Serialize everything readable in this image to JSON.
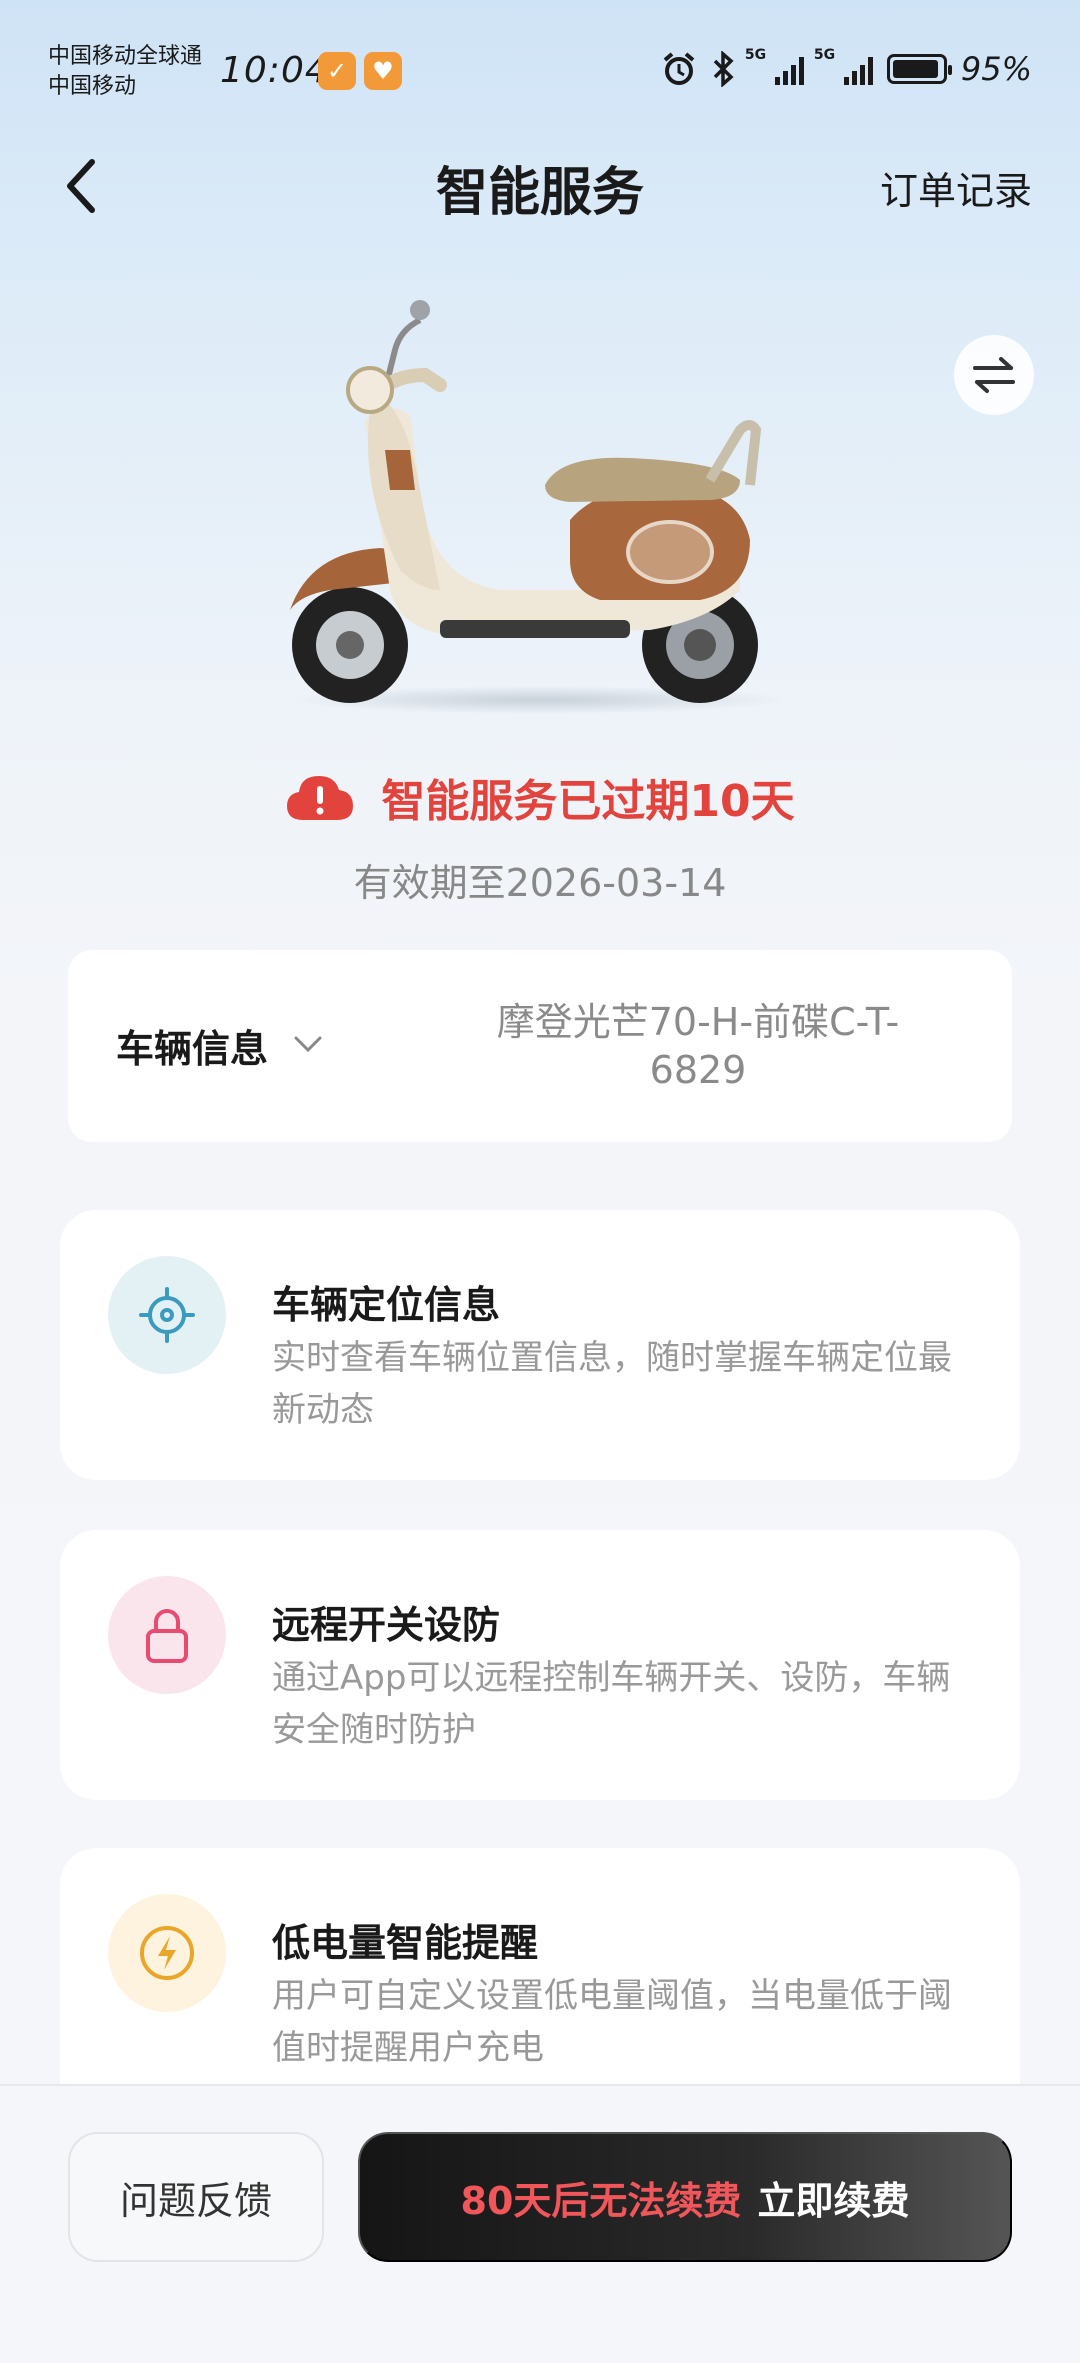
{
  "status_bar": {
    "carrier_1": "中国移动全球通",
    "carrier_2": "中国移动",
    "time": "10:04",
    "network_1": "5G",
    "network_2": "5G",
    "battery_text": "95%",
    "battery_level": 0.95,
    "icons": [
      "alarm-icon",
      "bluetooth-icon",
      "signal-icon",
      "battery-icon"
    ]
  },
  "header": {
    "title": "智能服务",
    "orders_link": "订单记录"
  },
  "status": {
    "expired_message": "智能服务已过期10天",
    "valid_until": "有效期至2026-03-14",
    "warning_color": "#e2443d"
  },
  "vehicle": {
    "label": "车辆信息",
    "name": "摩登光芒70-H-前碟C-T-6829"
  },
  "services": [
    {
      "title": "车辆定位信息",
      "description": "实时查看车辆位置信息，随时掌握车辆定位最新动态",
      "icon": "location-target-icon",
      "accent": "#3a9bbf"
    },
    {
      "title": "远程开关设防",
      "description": "通过App可以远程控制车辆开关、设防，车辆安全随时防护",
      "icon": "lock-icon",
      "accent": "#e84a72"
    },
    {
      "title": "低电量智能提醒",
      "description": "用户可自定义设置低电量阈值，当电量低于阈值时提醒用户充电",
      "icon": "lightning-icon",
      "accent": "#e9a628"
    }
  ],
  "footer": {
    "feedback_label": "问题反馈",
    "renew_warning": "80天后无法续费",
    "renew_action": "立即续费"
  }
}
